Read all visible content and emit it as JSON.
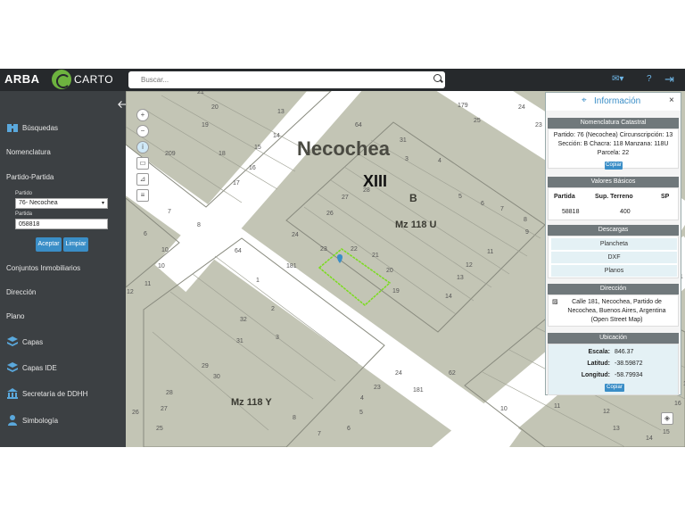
{
  "brand": {
    "arba": "ARBA",
    "carto": "CARTO"
  },
  "search": {
    "placeholder": "Buscar..."
  },
  "sidebar": {
    "busquedas": "Búsquedas",
    "nomenclatura": "Nomenclatura",
    "partido_partida": "Partido-Partida",
    "partido_label": "Partido",
    "partido_value": "76- Necochea",
    "partida_label": "Partida",
    "partida_value": "058818",
    "aceptar": "Aceptar",
    "limpiar": "Limpiar",
    "conjuntos": "Conjuntos Inmobiliarios",
    "direccion": "Dirección",
    "plano": "Plano",
    "capas": "Capas",
    "capas_ide": "Capas IDE",
    "secretaria": "Secretaría de DDHH",
    "simbologia": "Simbología"
  },
  "map": {
    "city": "Necochea",
    "circ": "XIII",
    "section": "B",
    "mz_u": "Mz 118 U",
    "mz_y": "Mz 118 Y",
    "street_labels": [
      "64",
      "179",
      "209",
      "64",
      "181",
      "62",
      "181"
    ],
    "parcels": [
      "21",
      "20",
      "13",
      "19",
      "14",
      "18",
      "15",
      "16",
      "17",
      "31",
      "3",
      "4",
      "5",
      "6",
      "7",
      "8",
      "9",
      "28",
      "27",
      "26",
      "24",
      "23",
      "22",
      "21",
      "20",
      "19",
      "14",
      "13",
      "12",
      "11",
      "10",
      "6",
      "7",
      "8",
      "12",
      "11",
      "10",
      "1",
      "2",
      "3",
      "32",
      "31",
      "30",
      "29",
      "28",
      "27",
      "26",
      "25",
      "24",
      "23",
      "4",
      "5",
      "6",
      "7",
      "8",
      "9",
      "10",
      "11",
      "12",
      "13",
      "14",
      "15",
      "16",
      "17",
      "18",
      "19",
      "20",
      "21",
      "22",
      "23",
      "24",
      "25",
      "26"
    ]
  },
  "info": {
    "title": "Información",
    "nomenclatura_header": "Nomenclatura Catastral",
    "nomenclatura_line1": "Partido: 76 (Necochea) Circunscripción: 13",
    "nomenclatura_line2": "Sección: B Chacra: 118 Manzana: 118U",
    "nomenclatura_line3": "Parcela: 22",
    "copiar": "Copiar",
    "valores_header": "Valores Básicos",
    "valores_cols": [
      "Partida",
      "Sup. Terreno",
      "SP"
    ],
    "valores_row": [
      "58818",
      "400",
      ""
    ],
    "descargas_header": "Descargas",
    "descargas": [
      "Plancheta",
      "DXF",
      "Planos"
    ],
    "direccion_header": "Dirección",
    "direccion_text": "Calle 181, Necochea, Partido de Necochea, Buenos Aires, Argentina (Open Street Map)",
    "ubicacion_header": "Ubicación",
    "escala_label": "Escala:",
    "escala_value": "846.37",
    "latitud_label": "Latitud:",
    "latitud_value": "-38.59872",
    "longitud_label": "Longitud:",
    "longitud_value": "-58.79934"
  },
  "colors": {
    "topbar": "#26292c",
    "sidebar": "#3c4043",
    "accent": "#3a8ec7",
    "parcel_highlight": "#7bdc1e",
    "map_bg": "#c3c5b5"
  }
}
